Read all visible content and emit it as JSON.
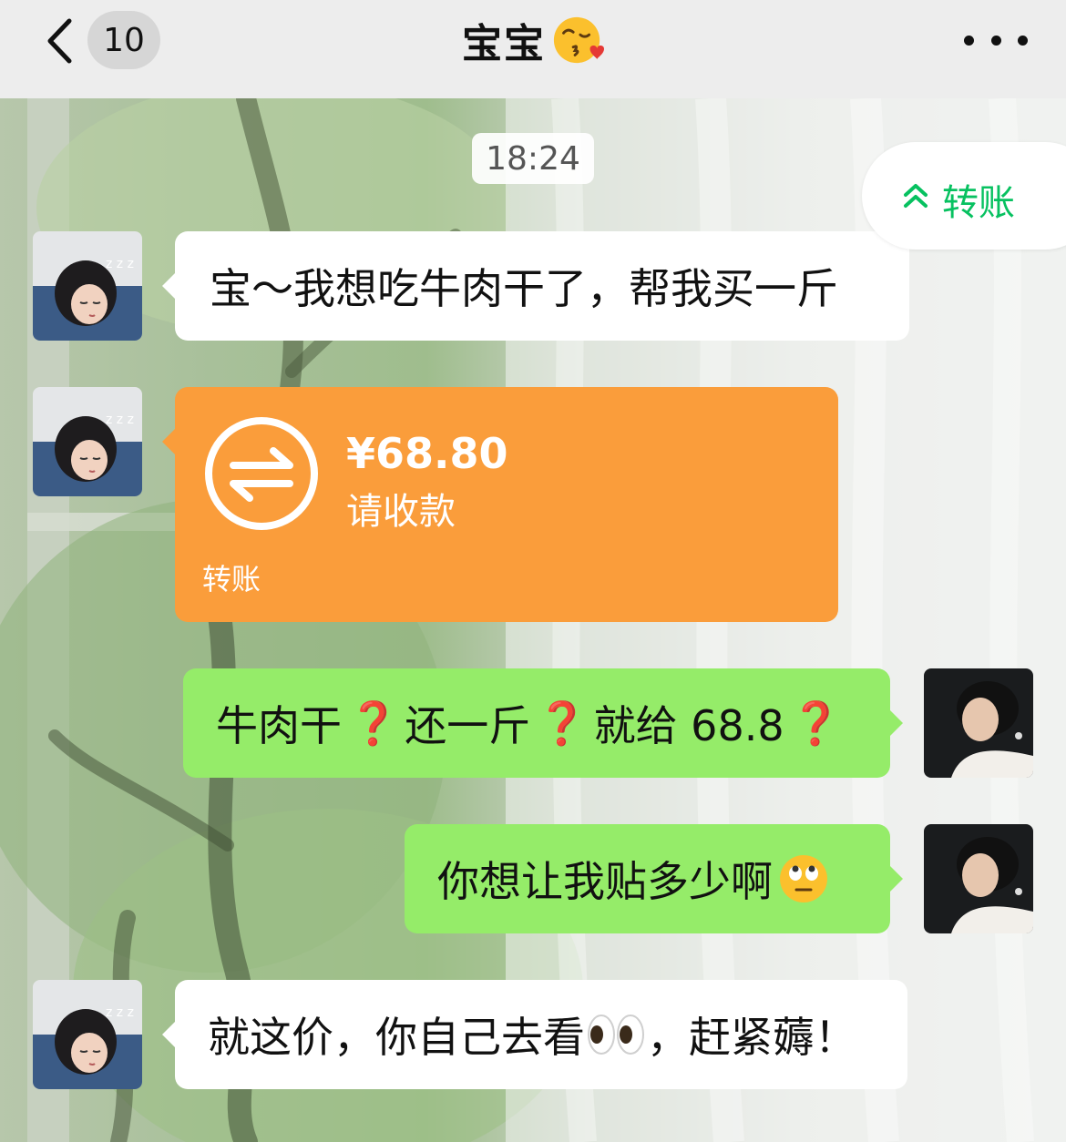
{
  "header": {
    "unread_count": "10",
    "title": "宝宝",
    "title_emoji": "kissing-face-with-heart-icon"
  },
  "chat": {
    "timestamp": "18:24",
    "floating_button_label": "转账",
    "messages": [
      {
        "side": "left",
        "type": "text",
        "text": "宝～我想吃牛肉干了，帮我买一斤"
      },
      {
        "side": "left",
        "type": "transfer",
        "amount": "¥68.80",
        "status": "请收款",
        "footer": "转账"
      },
      {
        "side": "right",
        "type": "text",
        "parts": [
          "牛肉干",
          "❓",
          "还一斤",
          "❓",
          "就给 68.8",
          "❓"
        ]
      },
      {
        "side": "right",
        "type": "text",
        "text": "你想让我贴多少啊",
        "emoji": "face-with-rolling-eyes-icon"
      },
      {
        "side": "left",
        "type": "text",
        "text_before": "就这价，你自己去看",
        "emoji": "eyes-icon",
        "text_after": "，赶紧薅！"
      }
    ]
  },
  "colors": {
    "header_bg": "#ededed",
    "white_bubble": "#ffffff",
    "green_bubble": "#95ec69",
    "transfer_orange": "#fa9d3b",
    "accent_green": "#07c160",
    "question_red": "#e8192c"
  }
}
